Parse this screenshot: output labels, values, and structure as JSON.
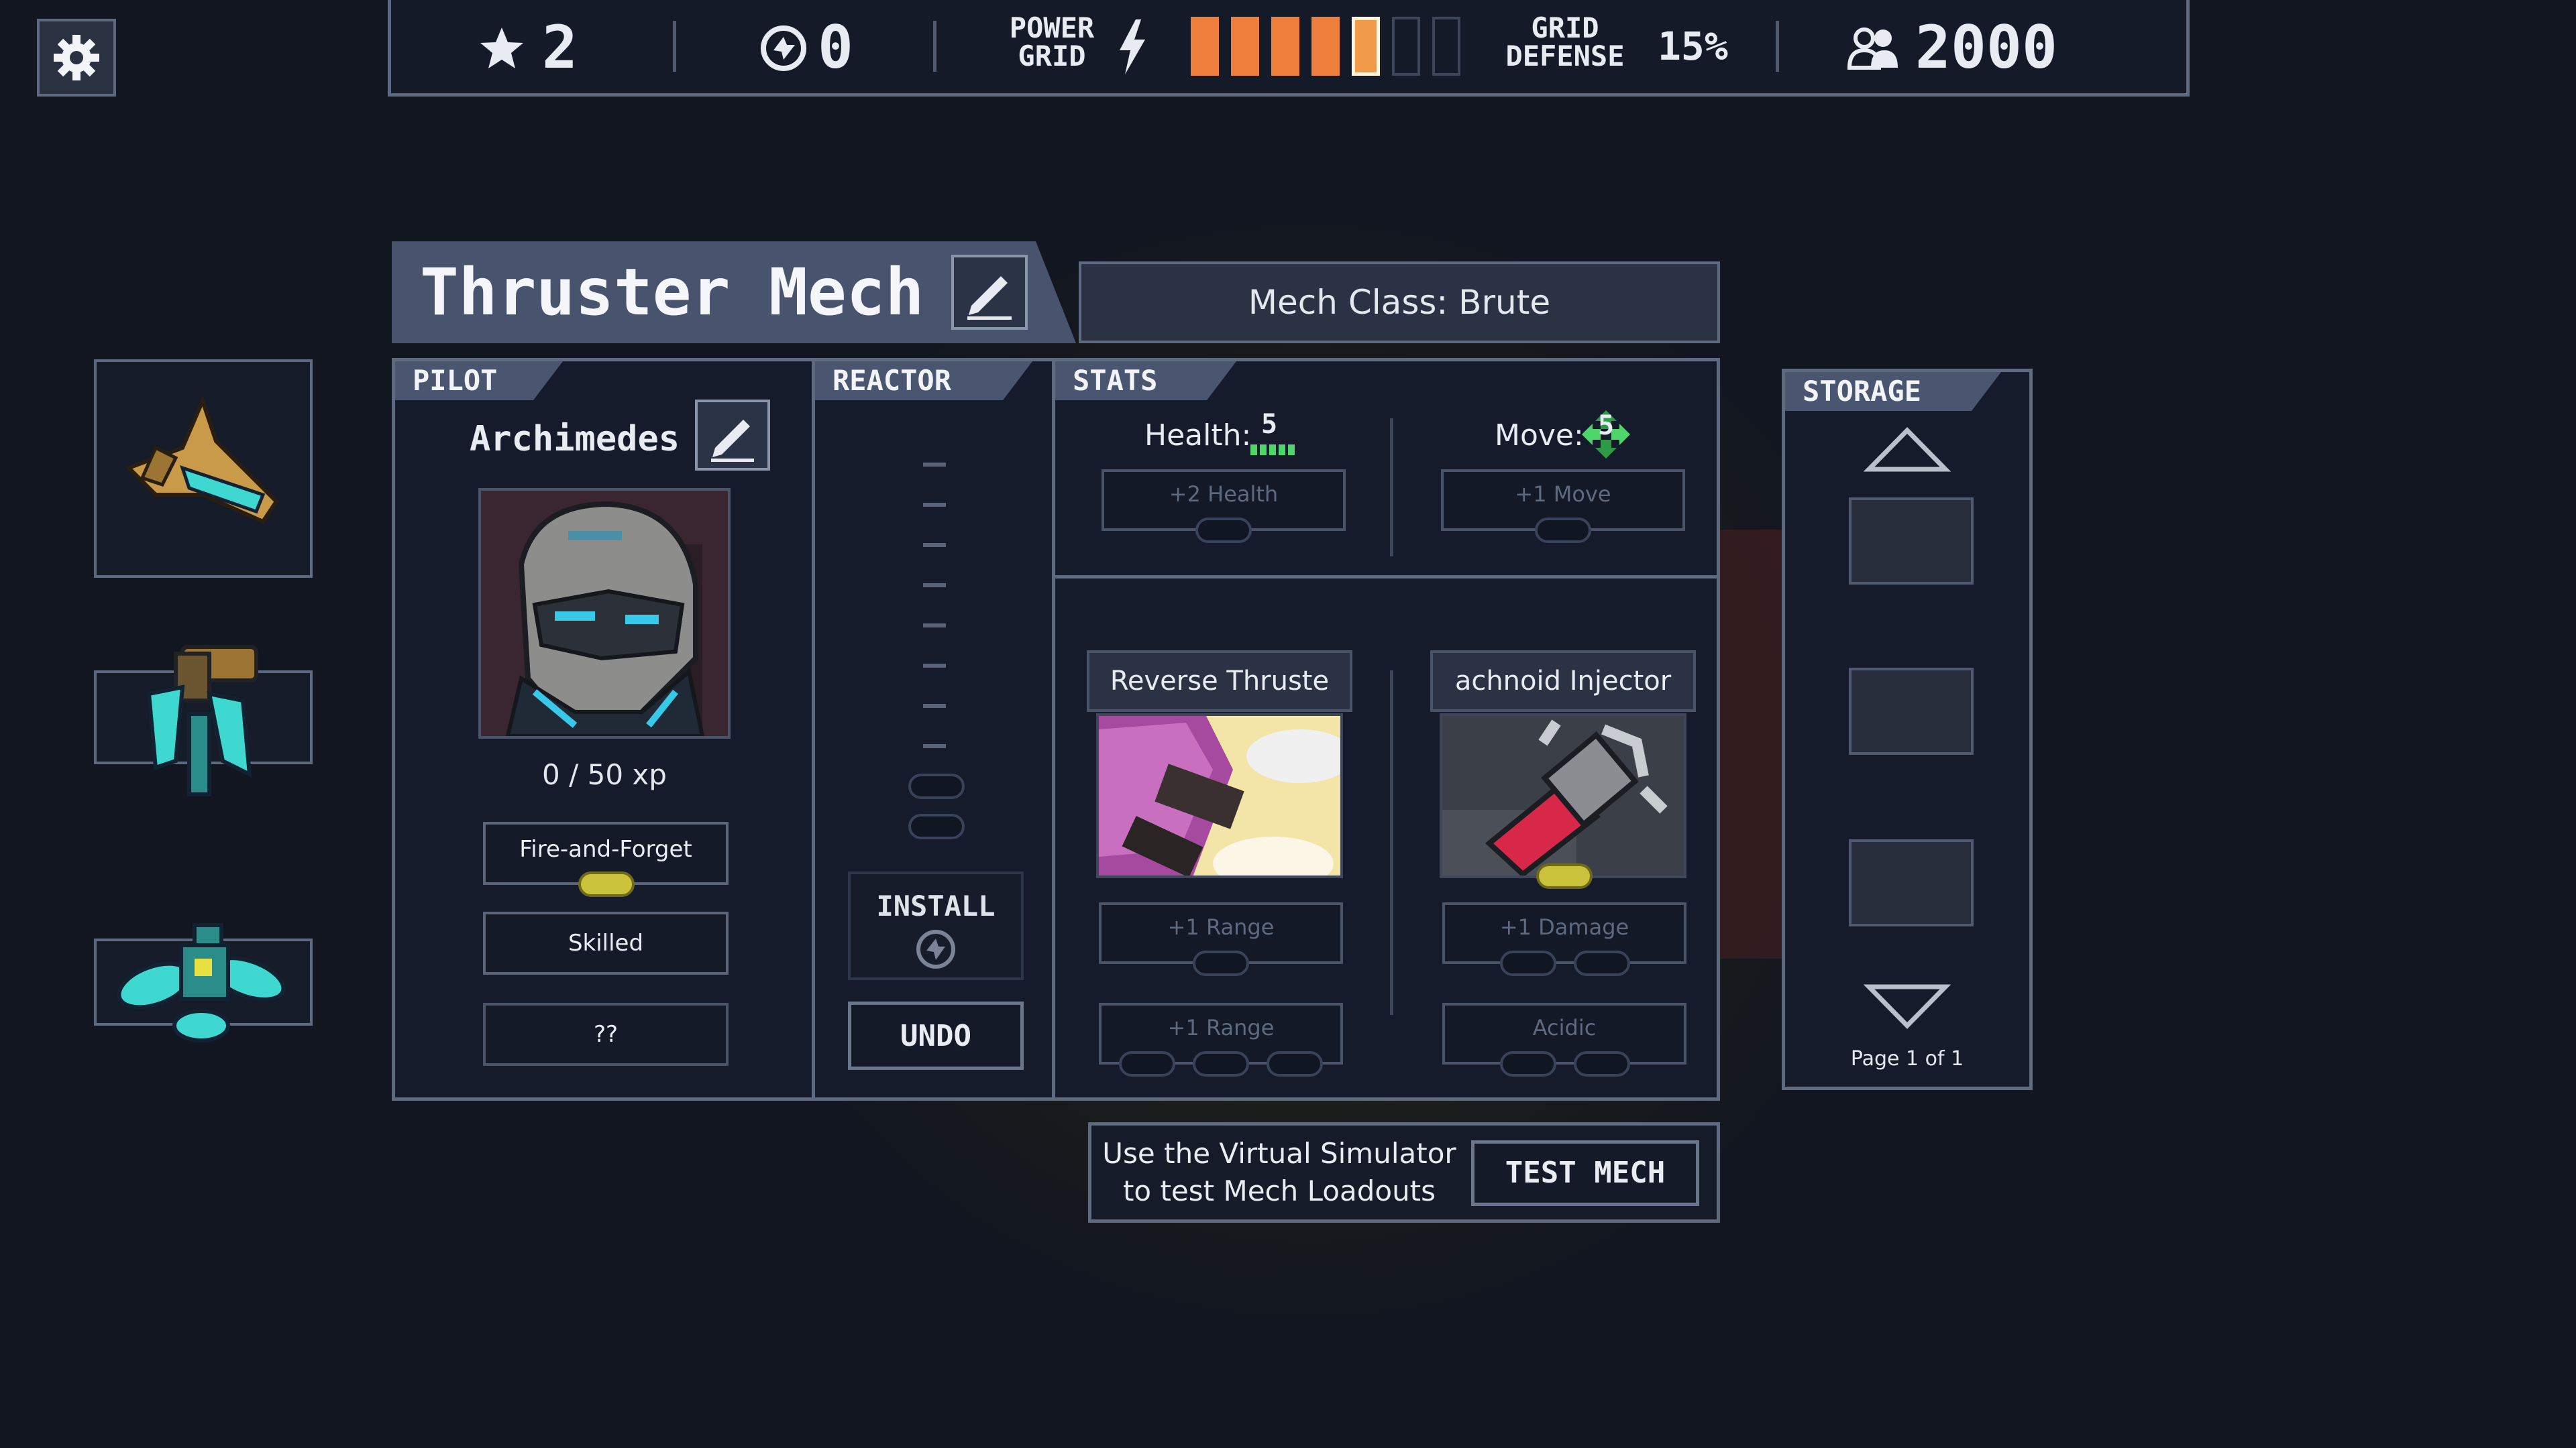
{
  "top_bar": {
    "stars": "2",
    "reputation": "0",
    "power_grid_line1": "POWER",
    "power_grid_line2": "GRID",
    "power_grid_filled": 5,
    "power_grid_total": 7,
    "grid_defense_line1": "GRID",
    "grid_defense_line2": "DEFENSE",
    "grid_defense_value": "15%",
    "population": "2000"
  },
  "mech": {
    "name": "Thruster Mech",
    "class": "Mech Class: Brute"
  },
  "pilot": {
    "tab": "PILOT",
    "name": "Archimedes",
    "xp": "0 / 50 xp",
    "skills": [
      "Fire-and-Forget",
      "Skilled",
      "??"
    ]
  },
  "reactor": {
    "tab": "REACTOR",
    "install_label": "INSTALL",
    "undo_label": "UNDO"
  },
  "stats": {
    "tab": "STATS",
    "health_label": "Health:",
    "health_value": "5",
    "move_label": "Move:",
    "move_value": "5",
    "health_upgrade": "+2 Health",
    "move_upgrade": "+1 Move"
  },
  "weapons": [
    {
      "name": "Reverse Thruste",
      "upgrades": [
        "+1 Range",
        "+1 Range"
      ]
    },
    {
      "name": "achnoid Injector",
      "upgrades": [
        "+1 Damage",
        "Acidic"
      ]
    }
  ],
  "storage": {
    "tab": "STORAGE",
    "page": "Page 1 of 1"
  },
  "simulator": {
    "text_line1": "Use the Virtual Simulator",
    "text_line2": "to test Mech Loadouts",
    "button": "TEST MECH"
  },
  "icons": {
    "settings": "gear-icon",
    "star": "star-icon",
    "reputation": "reputation-icon",
    "power": "lightning-icon",
    "population": "people-icon",
    "edit": "pencil-icon"
  },
  "colors": {
    "power_on": "#ee7f3c",
    "power_active": "#f29a4b",
    "panel": "#151b2a",
    "tab": "#4a5670",
    "accent_green": "#4fd66a",
    "accent_yellow": "#c9c23a"
  }
}
